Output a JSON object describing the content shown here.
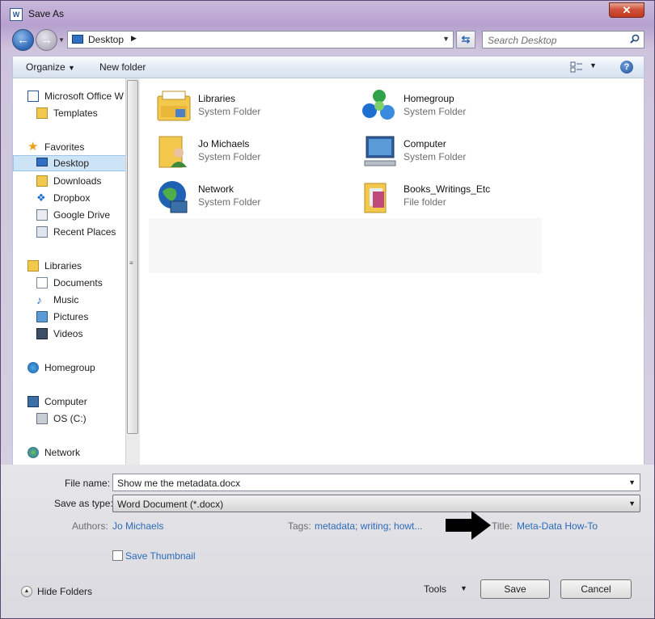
{
  "window": {
    "title": "Save As",
    "close_label": "✕"
  },
  "address": {
    "location": "Desktop",
    "search_placeholder": "Search Desktop"
  },
  "toolbar": {
    "organize": "Organize",
    "new_folder": "New folder"
  },
  "sidebar": {
    "items": [
      {
        "label": "Microsoft Office W",
        "icon": "word-icon"
      },
      {
        "label": "Templates",
        "icon": "folder-icon"
      },
      {
        "label": "Favorites",
        "icon": "star-icon"
      },
      {
        "label": "Desktop",
        "icon": "desktop-icon",
        "selected": true
      },
      {
        "label": "Downloads",
        "icon": "downloads-folder-icon"
      },
      {
        "label": "Dropbox",
        "icon": "dropbox-icon"
      },
      {
        "label": "Google Drive",
        "icon": "google-drive-icon"
      },
      {
        "label": "Recent Places",
        "icon": "recent-places-icon"
      },
      {
        "label": "Libraries",
        "icon": "libraries-icon"
      },
      {
        "label": "Documents",
        "icon": "documents-icon"
      },
      {
        "label": "Music",
        "icon": "music-icon"
      },
      {
        "label": "Pictures",
        "icon": "pictures-icon"
      },
      {
        "label": "Videos",
        "icon": "videos-icon"
      },
      {
        "label": "Homegroup",
        "icon": "homegroup-icon"
      },
      {
        "label": "Computer",
        "icon": "computer-icon"
      },
      {
        "label": "OS (C:)",
        "icon": "drive-icon"
      },
      {
        "label": "Network",
        "icon": "network-icon"
      }
    ]
  },
  "content": {
    "items": [
      {
        "name": "Libraries",
        "type": "System Folder",
        "icon": "libraries-icon"
      },
      {
        "name": "Homegroup",
        "type": "System Folder",
        "icon": "homegroup-icon"
      },
      {
        "name": "Jo Michaels",
        "type": "System Folder",
        "icon": "user-folder-icon"
      },
      {
        "name": "Computer",
        "type": "System Folder",
        "icon": "computer-icon"
      },
      {
        "name": "Network",
        "type": "System Folder",
        "icon": "network-icon"
      },
      {
        "name": "Books_Writings_Etc",
        "type": "File folder",
        "icon": "folder-icon"
      }
    ]
  },
  "form": {
    "file_name_label": "File name:",
    "file_name_value": "Show me the metadata.docx",
    "save_type_label": "Save as type:",
    "save_type_value": "Word Document (*.docx)",
    "authors_label": "Authors:",
    "authors_value": "Jo Michaels",
    "tags_label": "Tags:",
    "tags_value": "metadata; writing; howt...",
    "title_label": "Title:",
    "title_value": "Meta-Data How-To",
    "thumbnail_label": "Save Thumbnail"
  },
  "footer": {
    "hide_folders": "Hide Folders",
    "tools": "Tools",
    "save": "Save",
    "cancel": "Cancel"
  },
  "colors": {
    "link": "#2d6bb8",
    "selection": "#cde4f7",
    "close": "#c2391f"
  }
}
